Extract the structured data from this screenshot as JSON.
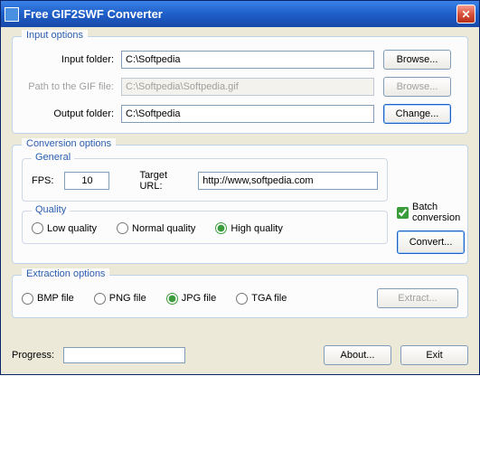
{
  "window": {
    "title": "Free GIF2SWF Converter"
  },
  "input": {
    "legend": "Input options",
    "input_folder_label": "Input folder:",
    "input_folder_value": "C:\\Softpedia",
    "gif_path_label": "Path to the GIF file:",
    "gif_path_value": "C:\\Softpedia\\Softpedia.gif",
    "output_folder_label": "Output folder:",
    "output_folder_value": "C:\\Softpedia",
    "browse_label": "Browse...",
    "change_label": "Change..."
  },
  "conversion": {
    "legend": "Conversion options",
    "general_legend": "General",
    "fps_label": "FPS:",
    "fps_value": "10",
    "url_label": "Target URL:",
    "url_value": "http://www,softpedia.com",
    "quality_legend": "Quality",
    "low": "Low quality",
    "normal": "Normal quality",
    "high": "High quality",
    "quality_selected": "high",
    "batch_label": "Batch conversion",
    "batch_checked": true,
    "convert_label": "Convert..."
  },
  "extraction": {
    "legend": "Extraction options",
    "bmp": "BMP file",
    "png": "PNG file",
    "jpg": "JPG file",
    "tga": "TGA file",
    "selected": "jpg",
    "extract_label": "Extract..."
  },
  "footer": {
    "progress_label": "Progress:",
    "about_label": "About...",
    "exit_label": "Exit"
  }
}
